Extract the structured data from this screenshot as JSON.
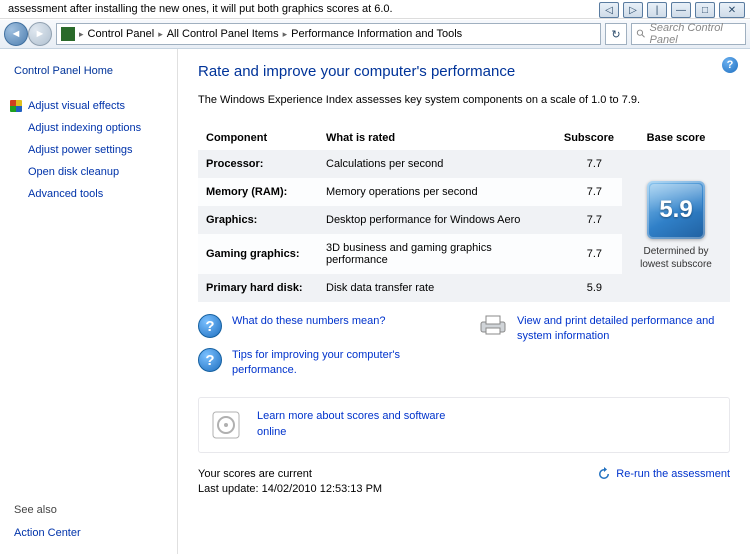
{
  "top_fragment": "assessment after installing the new ones, it will put both graphics scores at 6.0.",
  "breadcrumb": {
    "seg1": "Control Panel",
    "seg2": "All Control Panel Items",
    "seg3": "Performance Information and Tools"
  },
  "search": {
    "placeholder": "Search Control Panel"
  },
  "sidebar": {
    "home": "Control Panel Home",
    "items": [
      {
        "label": "Adjust visual effects",
        "shield": true
      },
      {
        "label": "Adjust indexing options",
        "shield": false
      },
      {
        "label": "Adjust power settings",
        "shield": false
      },
      {
        "label": "Open disk cleanup",
        "shield": false
      },
      {
        "label": "Advanced tools",
        "shield": false
      }
    ],
    "see_also_head": "See also",
    "see_also": [
      {
        "label": "Action Center"
      }
    ]
  },
  "content": {
    "title": "Rate and improve your computer's performance",
    "intro": "The Windows Experience Index assesses key system components on a scale of 1.0 to 7.9.",
    "headers": {
      "component": "Component",
      "rated": "What is rated",
      "subscore": "Subscore",
      "base": "Base score"
    },
    "rows": [
      {
        "name": "Processor:",
        "rated": "Calculations per second",
        "sub": "7.7"
      },
      {
        "name": "Memory (RAM):",
        "rated": "Memory operations per second",
        "sub": "7.7"
      },
      {
        "name": "Graphics:",
        "rated": "Desktop performance for Windows Aero",
        "sub": "7.7"
      },
      {
        "name": "Gaming graphics:",
        "rated": "3D business and gaming graphics performance",
        "sub": "7.7"
      },
      {
        "name": "Primary hard disk:",
        "rated": "Disk data transfer rate",
        "sub": "5.9"
      }
    ],
    "base_score": "5.9",
    "base_caption": "Determined by lowest subscore",
    "links": {
      "numbers": "What do these numbers mean?",
      "tips": "Tips for improving your computer's performance.",
      "detailed": "View and print detailed performance and system information",
      "learn": "Learn more about scores and software online"
    },
    "status": {
      "current": "Your scores are current",
      "updated": "Last update: 14/02/2010 12:53:13 PM",
      "rerun": "Re-run the assessment"
    }
  }
}
